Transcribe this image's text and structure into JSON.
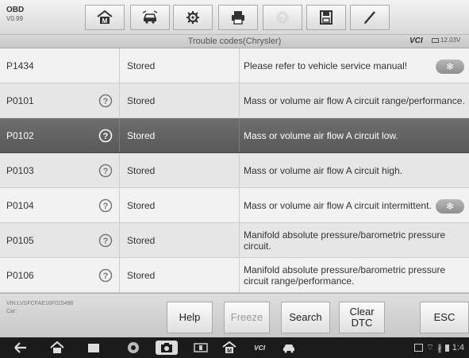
{
  "toolbar": {
    "obd_label": "OBD",
    "version": "V0.99",
    "buttons": [
      {
        "name": "home-icon",
        "enabled": true
      },
      {
        "name": "vehicle-swap-icon",
        "enabled": true
      },
      {
        "name": "settings-icon",
        "enabled": true
      },
      {
        "name": "print-icon",
        "enabled": true
      },
      {
        "name": "help-icon",
        "enabled": false
      },
      {
        "name": "save-icon",
        "enabled": true
      },
      {
        "name": "edit-icon",
        "enabled": true
      }
    ]
  },
  "subheader": {
    "title": "Trouble codes(Chrysler)",
    "vci": "VCI",
    "battery_voltage": "12.03V"
  },
  "dtc_rows": [
    {
      "code": "P1434",
      "has_help": false,
      "status": "Stored",
      "description": "Please refer to vehicle service manual!",
      "has_freeze": true,
      "selected": false
    },
    {
      "code": "P0101",
      "has_help": true,
      "status": "Stored",
      "description": "Mass or volume air flow A circuit range/performance.",
      "has_freeze": false,
      "selected": false
    },
    {
      "code": "P0102",
      "has_help": true,
      "status": "Stored",
      "description": "Mass or volume air flow A circuit low.",
      "has_freeze": false,
      "selected": true
    },
    {
      "code": "P0103",
      "has_help": true,
      "status": "Stored",
      "description": "Mass or volume air flow A circuit high.",
      "has_freeze": false,
      "selected": false
    },
    {
      "code": "P0104",
      "has_help": true,
      "status": "Stored",
      "description": "Mass or volume air flow A circuit intermittent.",
      "has_freeze": true,
      "selected": false
    },
    {
      "code": "P0105",
      "has_help": true,
      "status": "Stored",
      "description": "Manifold absolute pressure/barometric pressure circuit.",
      "has_freeze": false,
      "selected": false
    },
    {
      "code": "P0106",
      "has_help": true,
      "status": "Stored",
      "description": "Manifold absolute pressure/barometric pressure circuit range/performance.",
      "has_freeze": false,
      "selected": false
    }
  ],
  "footer": {
    "vin": "VIN:LVSFCFAE16F015498",
    "car": "Car:",
    "buttons": {
      "help": "Help",
      "freeze": "Freeze",
      "search": "Search",
      "clear_dtc": "Clear\nDTC",
      "esc": "ESC"
    },
    "freeze_enabled": false
  },
  "navbar": {
    "icons": [
      "back-icon",
      "home-icon",
      "recents-icon",
      "browser-icon",
      "camera-icon",
      "display-icon",
      "maxisys-icon",
      "vci-icon",
      "car-icon"
    ],
    "time": "1:4"
  }
}
